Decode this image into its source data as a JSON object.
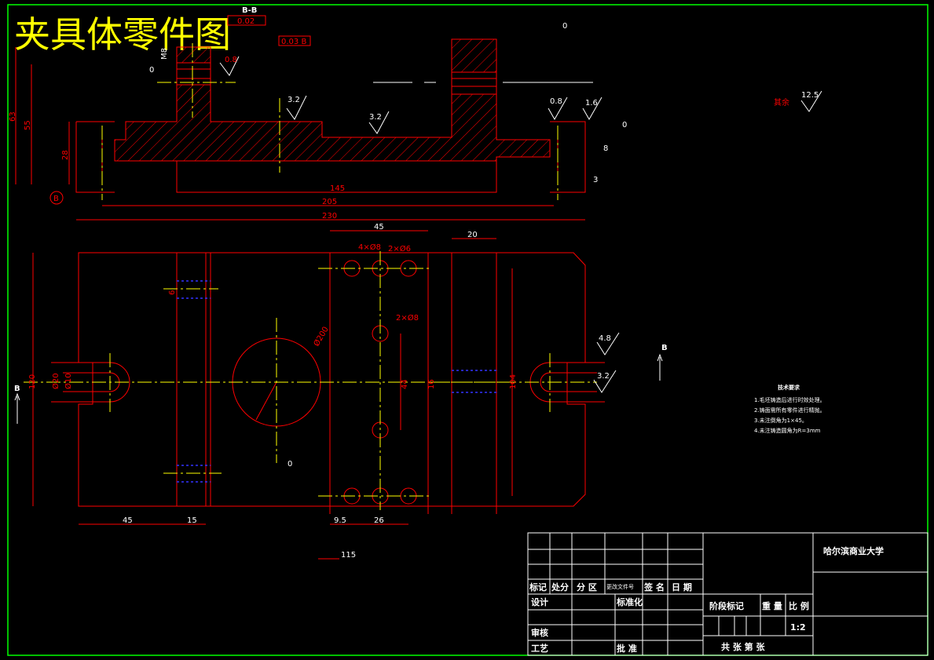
{
  "drawing_title": "夹具体零件图",
  "section_label": "B-B",
  "view_arrow_label": "B",
  "datum_label": "B",
  "tolerance_frames": [
    "0.02",
    "0.03 B"
  ],
  "dims": {
    "d145": "145",
    "d205": "205",
    "d230": "230",
    "d63": "63",
    "d55": "55",
    "d28": "28",
    "m8": "M8",
    "d45_top": "45",
    "d20_top": "20",
    "d4x8": "4×Ø8",
    "d2x6": "2×Ø6",
    "d2x8": "2×Ø8",
    "d200": "Ø200",
    "d44": "44",
    "d104": "104",
    "d120": "120",
    "d20": "Ø20",
    "d10": "Ø10",
    "d45_bot": "45",
    "d15": "15",
    "d9_5": "9.5",
    "d26": "26",
    "d115": "115",
    "d16": "16",
    "d6": "6",
    "d0": "0",
    "d8": "8",
    "d3": "3"
  },
  "roughness": [
    "0.8",
    "0",
    "3.2",
    "3.2",
    "0.8",
    "1.6",
    "0",
    "12.5",
    "4.8",
    "3.2"
  ],
  "roughness_note": "其余",
  "tech_requirements": {
    "heading": "技术要求",
    "items": [
      "1.毛坯铸造后进行时效处理。",
      "2.铸面需所有零件进行精抛。",
      "3.未注倒角为1×45。",
      "4.未注铸造圆角为R=3mm"
    ]
  },
  "title_block": {
    "university": "哈尔滨商业大学",
    "headers": [
      "标记",
      "处分",
      "分 区",
      "更改文件号",
      "签 名",
      "日 期"
    ],
    "design": "设计",
    "standardize": "标准化",
    "review": "审核",
    "process": "工艺",
    "approve": "批 准",
    "stage_mark": "阶段标记",
    "weight": "重 量",
    "scale_label": "比 例",
    "scale": "1:2",
    "sheets": "共    张  第    张"
  },
  "colors": {
    "background": "#000000",
    "outline": "#ff0000",
    "centerline": "#ffff00",
    "hidden": "#3333ff",
    "frame": "#00ff00",
    "text": "#ffffff",
    "title": "#ffff00"
  }
}
